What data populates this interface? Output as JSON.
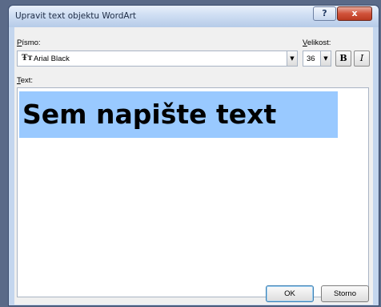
{
  "window": {
    "title": "Upravit text objektu WordArt",
    "help_label": "?",
    "close_label": "x"
  },
  "font": {
    "label_mnemonic": "P",
    "label_rest": "ísmo:",
    "value": "Arial Black",
    "icon": "Ŧт"
  },
  "size": {
    "label_mnemonic": "V",
    "label_rest": "elikost:",
    "value": "36"
  },
  "style": {
    "bold_label": "B",
    "italic_label": "I"
  },
  "text": {
    "label_mnemonic": "T",
    "label_rest": "ext:",
    "value": "Sem napište text",
    "selection_color": "#99c9ff"
  },
  "buttons": {
    "ok_label": "OK",
    "cancel_label": "Storno"
  },
  "dropdown_arrow": "▼"
}
